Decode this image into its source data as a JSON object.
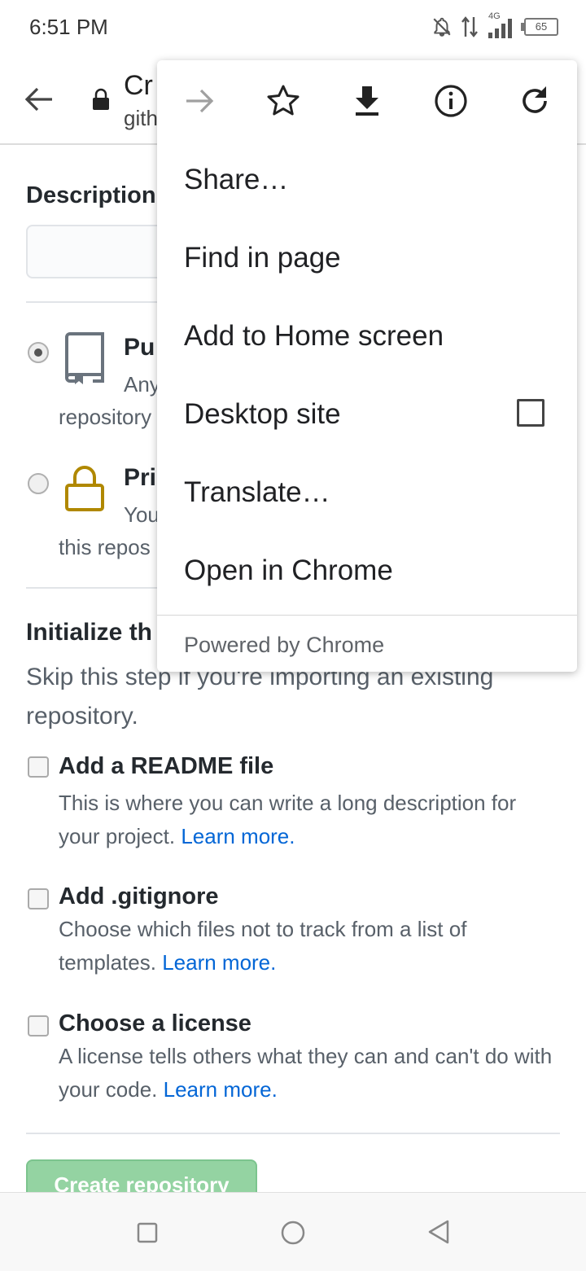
{
  "status_bar": {
    "time": "6:51 PM",
    "network": "4G",
    "battery": "65"
  },
  "toolbar": {
    "title": "Cr",
    "url": "gith"
  },
  "page": {
    "description_label": "Description",
    "public": {
      "title": "Pu",
      "desc_line1": "Any",
      "desc_line2": "repository"
    },
    "private": {
      "title": "Pri",
      "desc_line1": "You",
      "desc_line2": "this repos"
    },
    "init_title": "Initialize th",
    "init_desc": "Skip this step if you're importing an existing repository.",
    "readme": {
      "title": "Add a README file",
      "desc": "This is where you can write a long description for your project.",
      "link": "Learn more."
    },
    "gitignore": {
      "title": "Add .gitignore",
      "desc": "Choose which files not to track from a list of templates.",
      "link": "Learn more."
    },
    "license": {
      "title": "Choose a license",
      "desc": "A license tells others what they can and can't do with your code.",
      "link": "Learn more."
    },
    "create_button": "Create repository"
  },
  "menu": {
    "icons": [
      "forward-icon",
      "bookmark-star-icon",
      "download-icon",
      "info-icon",
      "reload-icon"
    ],
    "items": [
      "Share…",
      "Find in page",
      "Add to Home screen",
      "Desktop site",
      "Translate…",
      "Open in Chrome"
    ],
    "desktop_site_checked": false,
    "footer": "Powered by Chrome"
  }
}
